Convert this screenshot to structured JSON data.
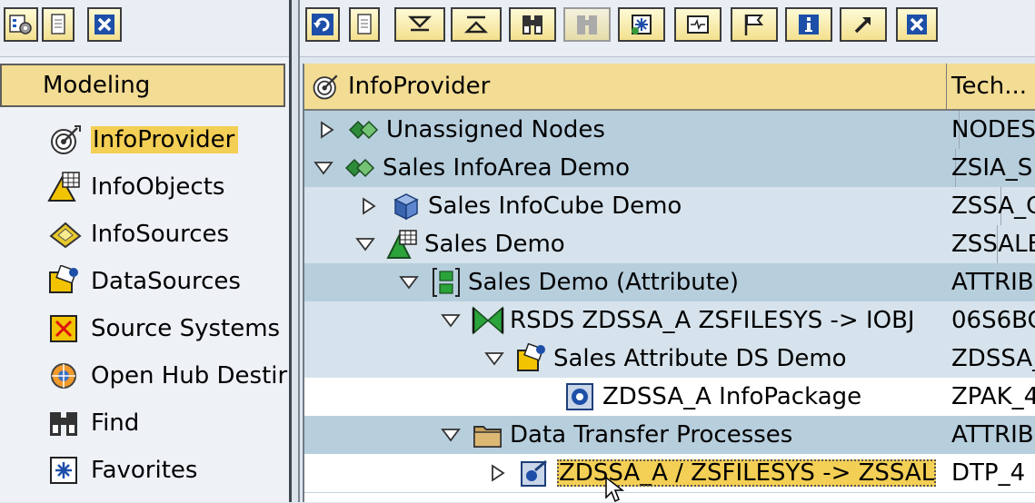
{
  "left_toolbar": {
    "buttons": [
      {
        "icon": "tree-settings-icon",
        "interactable": true
      },
      {
        "icon": "document-icon",
        "interactable": true
      },
      {
        "icon": "close-icon",
        "interactable": true
      }
    ]
  },
  "nav": {
    "header": "Modeling",
    "items": [
      {
        "label": "InfoProvider",
        "icon": "infoprovider-icon",
        "selected": true
      },
      {
        "label": "InfoObjects",
        "icon": "infoobject-icon",
        "selected": false
      },
      {
        "label": "InfoSources",
        "icon": "infosource-icon",
        "selected": false
      },
      {
        "label": "DataSources",
        "icon": "datasource-icon",
        "selected": false
      },
      {
        "label": "Source Systems",
        "icon": "source-system-icon",
        "selected": false
      },
      {
        "label": "Open Hub Destir",
        "icon": "open-hub-icon",
        "selected": false
      },
      {
        "label": "Find",
        "icon": "binoculars-icon",
        "selected": false
      },
      {
        "label": "Favorites",
        "icon": "favorites-icon",
        "selected": false
      }
    ]
  },
  "right_toolbar": {
    "buttons": [
      {
        "icon": "refresh-icon"
      },
      {
        "icon": "document-icon"
      },
      {
        "icon": "expand-all-icon"
      },
      {
        "icon": "collapse-all-icon"
      },
      {
        "icon": "binoculars-icon"
      },
      {
        "icon": "find-next-icon",
        "disabled": true
      },
      {
        "icon": "favorite-add-icon"
      },
      {
        "icon": "display-icon"
      },
      {
        "icon": "flag-icon"
      },
      {
        "icon": "info-icon"
      },
      {
        "icon": "arrow-icon"
      },
      {
        "icon": "close-icon"
      }
    ]
  },
  "tree": {
    "columns": [
      "InfoProvider",
      "Tech..."
    ],
    "rows": [
      {
        "label": "Unassigned Nodes",
        "tech": "NODES",
        "icon": "infoarea-icon",
        "expander": "collapsed",
        "bg": "blue"
      },
      {
        "label": "Sales InfoArea Demo",
        "tech": "ZSIA_S",
        "icon": "infoarea-icon",
        "expander": "expanded",
        "bg": "blue"
      },
      {
        "label": "Sales InfoCube Demo",
        "tech": "ZSSA_C",
        "icon": "infocube-icon",
        "expander": "collapsed",
        "bg": "lightblue"
      },
      {
        "label": "Sales Demo",
        "tech": "ZSSALE",
        "icon": "infoobject-icon",
        "expander": "expanded",
        "bg": "lightblue"
      },
      {
        "label": "Sales Demo (Attribute)",
        "tech": "ATTRIB",
        "icon": "attribute-icon",
        "expander": "expanded",
        "bg": "blue"
      },
      {
        "label": "RSDS ZDSSA_A ZSFILESYS -> IOBJ",
        "tech": "06S6BC",
        "icon": "transformation-icon",
        "expander": "expanded",
        "bg": "lightblue"
      },
      {
        "label": "Sales Attribute DS Demo",
        "tech": "ZDSSA_",
        "icon": "datasource-icon",
        "expander": "expanded",
        "bg": "lightblue"
      },
      {
        "label": "ZDSSA_A InfoPackage",
        "tech": "ZPAK_4",
        "icon": "infopackage-icon",
        "expander": "none",
        "bg": "white"
      },
      {
        "label": "Data Transfer Processes",
        "tech": "ATTRIB",
        "icon": "folder-icon",
        "expander": "expanded",
        "bg": "blue"
      },
      {
        "label": "ZDSSA_A / ZSFILESYS -> ZSSAL",
        "tech": "DTP_4",
        "icon": "dtp-icon",
        "expander": "collapsed",
        "bg": "white",
        "selected": true
      }
    ]
  }
}
